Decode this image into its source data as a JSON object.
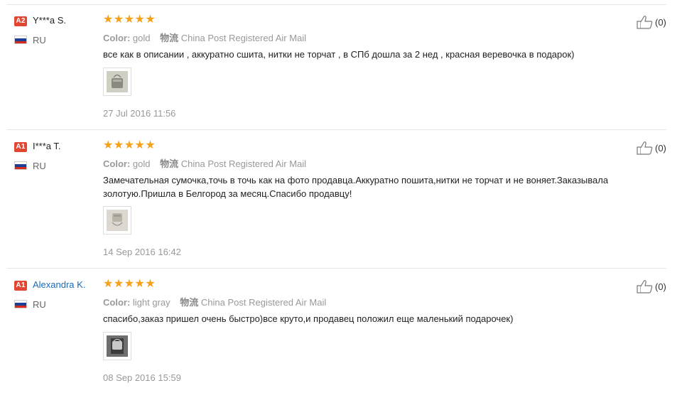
{
  "reviews": [
    {
      "level": "A2",
      "name": "Y***a S.",
      "country": "RU",
      "stars": "★★★★★",
      "color_label": "Color:",
      "color_value": "gold",
      "logistics_label": "物流",
      "logistics_value": "China Post Registered Air Mail",
      "text": "все как в описании , аккуратно сшита, нитки не торчат , в СПб дошла за 2 нед , красная веревочка в подарок)",
      "date": "27 Jul 2016 11:56",
      "likes": "(0)"
    },
    {
      "level": "A1",
      "name": "I***a T.",
      "country": "RU",
      "stars": "★★★★★",
      "color_label": "Color:",
      "color_value": "gold",
      "logistics_label": "物流",
      "logistics_value": "China Post Registered Air Mail",
      "text": "Замечательная сумочка,точь в точь как на фото продавца.Аккуратно пошита,нитки не торчат и не воняет.Заказывала золотую.Пришла в Белгород за месяц.Спасибо продавцу!",
      "date": "14 Sep 2016 16:42",
      "likes": "(0)"
    },
    {
      "level": "A1",
      "name": "Alexandra K.",
      "country": "RU",
      "stars": "★★★★★",
      "color_label": "Color:",
      "color_value": "light gray",
      "logistics_label": "物流",
      "logistics_value": "China Post Registered Air Mail",
      "text": "спасибо,заказ пришел очень быстро)все круто,и продавец положил еще маленький подарочек)",
      "date": "08 Sep 2016 15:59",
      "likes": "(0)"
    }
  ],
  "colors": {
    "badge": "#e24632",
    "star": "#f7a01a",
    "link": "#1a6bb8",
    "muted": "#999999"
  },
  "icons": {
    "like": "thumbs-up-icon",
    "flag": "russia-flag-icon"
  }
}
